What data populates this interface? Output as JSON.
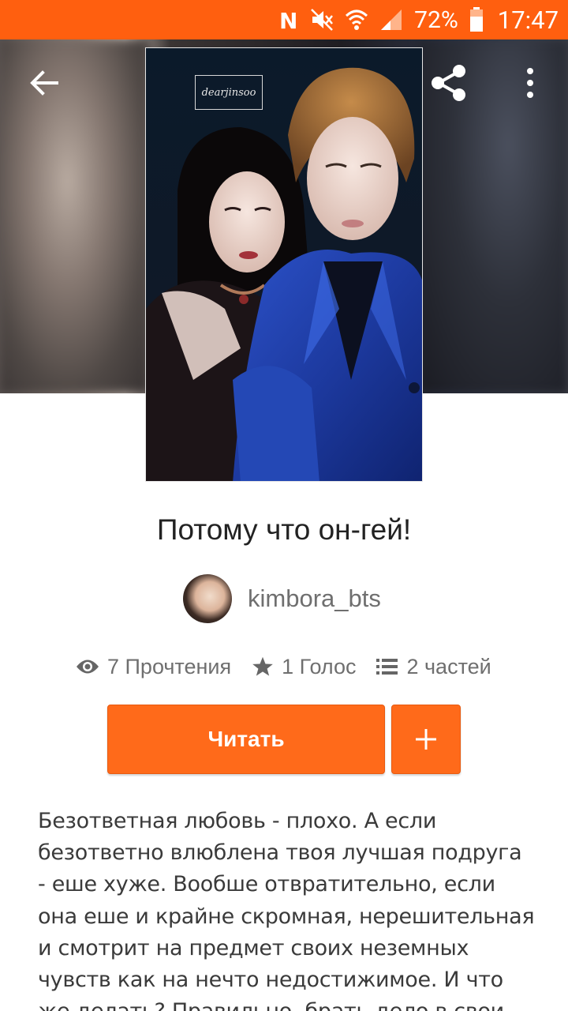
{
  "status_bar": {
    "battery_percent": "72%",
    "time": "17:47",
    "icons": [
      "nfc-icon",
      "mute-icon",
      "wifi-icon",
      "signal-icon",
      "battery-icon"
    ]
  },
  "top_bar": {
    "icons": [
      "back-arrow-icon",
      "share-icon",
      "more-vert-icon"
    ]
  },
  "cover": {
    "watermark_text": "dearjinsoo"
  },
  "story": {
    "title": "Потому что он-гей!",
    "author": "kimbora_bts",
    "stats": {
      "reads": "7 Прочтения",
      "votes": "1 Голос",
      "parts": "2 частей"
    },
    "read_button_label": "Читать",
    "add_button_icon": "plus-icon",
    "description": "Безответная любовь - плохо. А если безответно влюблена твоя лучшая подруга - еше хуже. Вообше отвратительно, если она еше и крайне скромная, нерешительная и смотрит на предмет своих неземных чувств как на нечто недостижимое. И что же делать? Правильно, брать дело в свои руки и срочно"
  },
  "colors": {
    "status_bar": "#ff5f0f",
    "accent": "#ff6a1a",
    "title_text": "#222222",
    "secondary_text": "#6f6f6f"
  }
}
